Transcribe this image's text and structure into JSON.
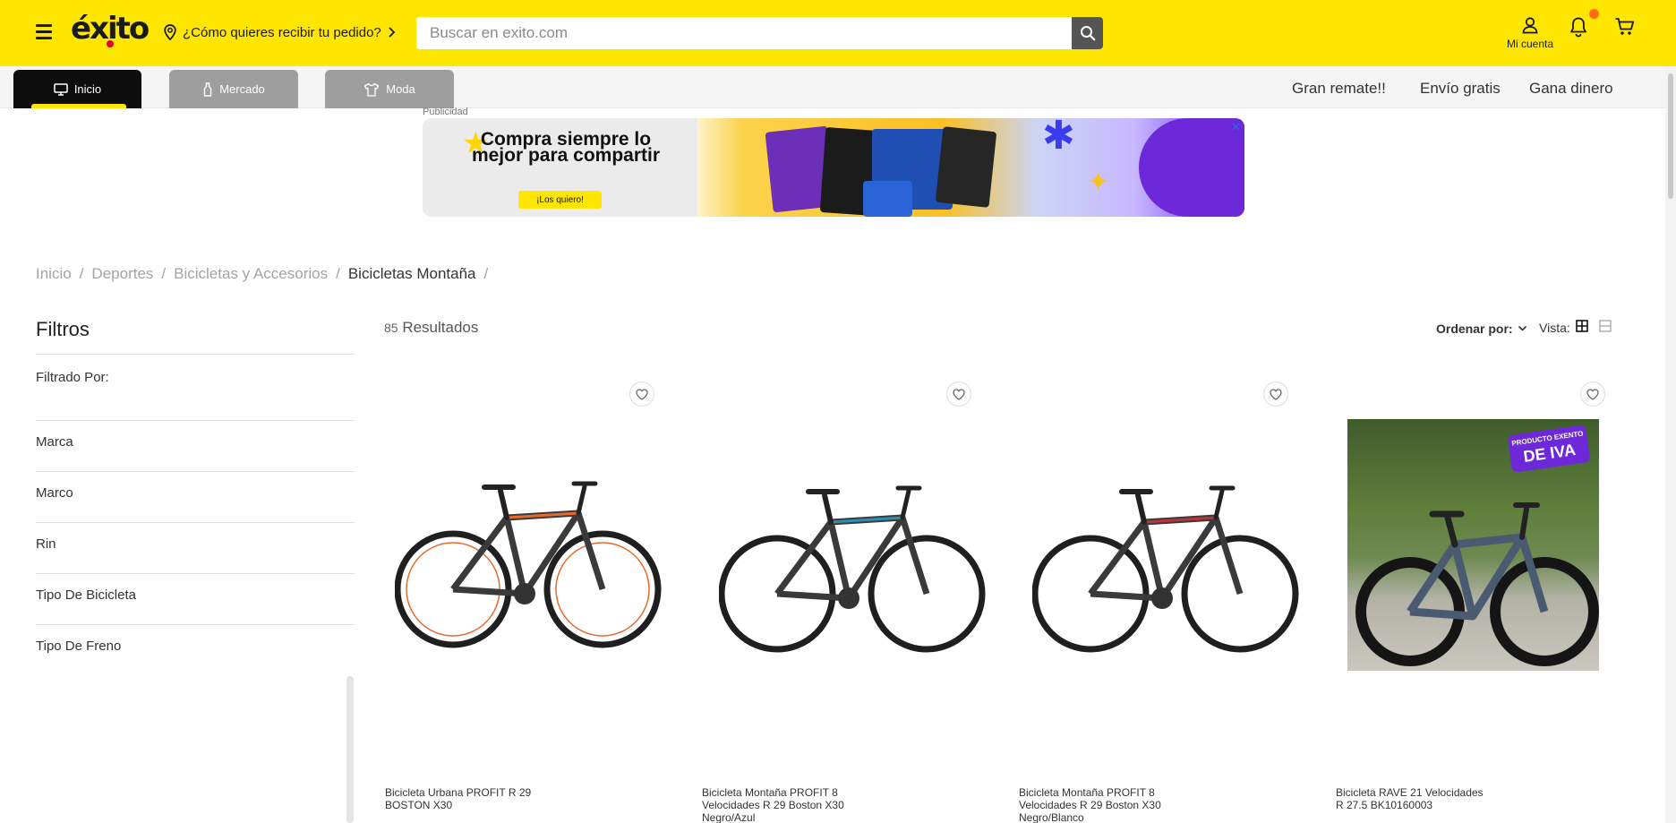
{
  "header": {
    "logo": "éxito",
    "delivery_prompt": "¿Cómo quieres recibir tu pedido?",
    "search_placeholder": "Buscar en exito.com",
    "account_label": "Mi cuenta"
  },
  "subnav": {
    "tabs": [
      {
        "label": "Inicio",
        "icon": "monitor-icon",
        "active": true
      },
      {
        "label": "Mercado",
        "icon": "bottle-icon",
        "active": false
      },
      {
        "label": "Moda",
        "icon": "shirt-icon",
        "active": false
      }
    ],
    "links": [
      "Gran remate!!",
      "Envío gratis",
      "Gana dinero"
    ]
  },
  "ad": {
    "label": "Publicidad",
    "headline": "Compra siempre lo mejor para compartir",
    "cta": "¡Los quiero!",
    "close": "✕"
  },
  "breadcrumb": {
    "items": [
      "Inicio",
      "Deportes",
      "Bicicletas y Accesorios",
      "Bicicletas Montaña"
    ],
    "separator": "/"
  },
  "filters": {
    "title": "Filtros",
    "filtered_by": "Filtrado Por:",
    "items": [
      "Marca",
      "Marco",
      "Rin",
      "Tipo De Bicicleta",
      "Tipo De Freno"
    ]
  },
  "results": {
    "count": "85",
    "label": "Resultados",
    "sort_label": "Ordenar por:",
    "view_label": "Vista:"
  },
  "products": [
    {
      "name": "Bicicleta Urbana PROFIT R 29 BOSTON X30",
      "frame_color": "#e8692b"
    },
    {
      "name": "Bicicleta Montaña PROFIT 8 Velocidades R 29 Boston X30 Negro/Azul",
      "frame_color": "#2a8fb4"
    },
    {
      "name": "Bicicleta Montaña PROFIT 8 Velocidades R 29 Boston X30 Negro/Blanco",
      "frame_color": "#c0303b"
    },
    {
      "name": "Bicicleta RAVE 21 Velocidades R 27.5 BK10160003",
      "badge_line1": "PRODUCTO EXENTO",
      "badge_line2": "DE IVA"
    }
  ],
  "colors": {
    "brand_yellow": "#ffe600",
    "dark": "#1a1a1a",
    "badge_purple": "#6d28d9",
    "notification": "#ff6b1a"
  }
}
